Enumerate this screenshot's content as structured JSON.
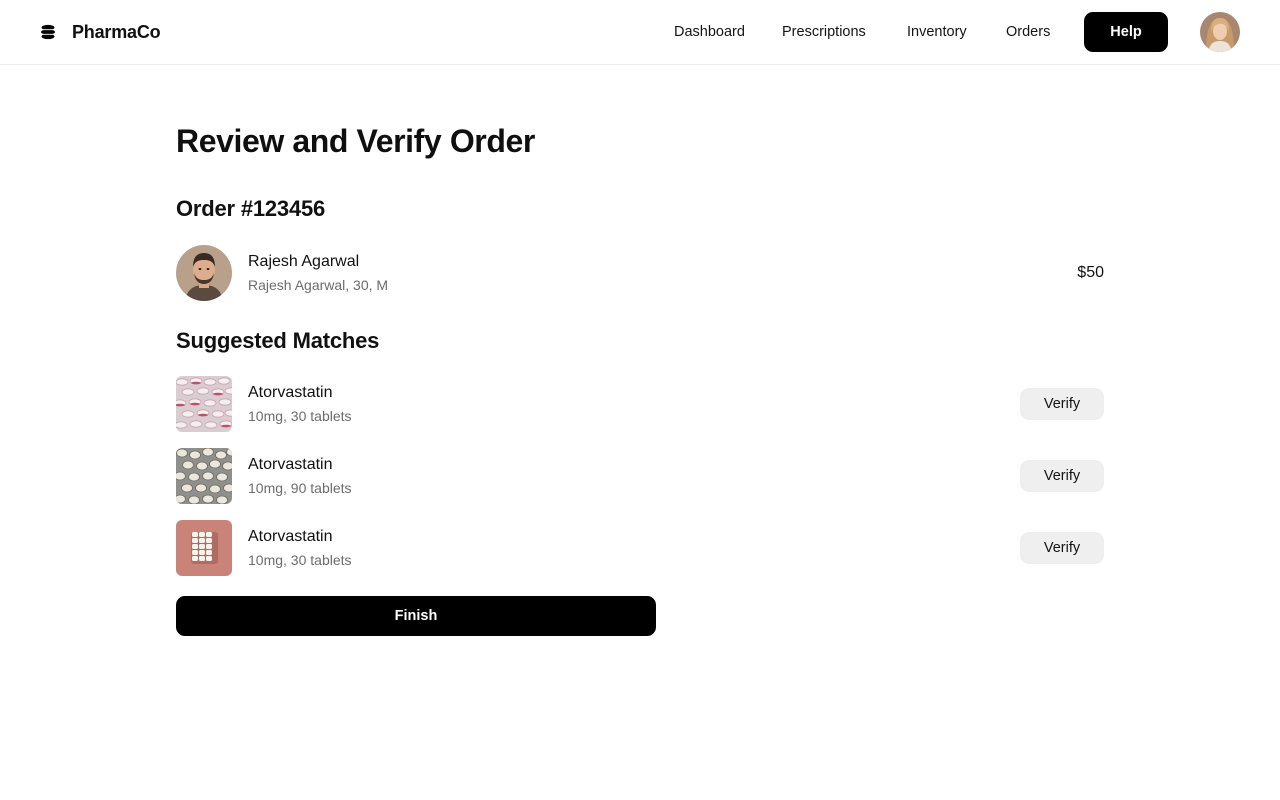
{
  "header": {
    "brand": "PharmaCo",
    "brand_icon": "stacked-layers-icon",
    "nav": [
      "Dashboard",
      "Prescriptions",
      "Inventory",
      "Orders"
    ],
    "help_label": "Help",
    "avatar_icon": "user-avatar"
  },
  "page": {
    "title": "Review and Verify Order"
  },
  "order": {
    "title": "Order #123456",
    "customer": {
      "name": "Rajesh Agarwal",
      "details": "Rajesh Agarwal, 30, M"
    },
    "price": "$50"
  },
  "matches": {
    "title": "Suggested Matches",
    "items": [
      {
        "name": "Atorvastatin",
        "detail": "10mg, 30 tablets",
        "action": "Verify"
      },
      {
        "name": "Atorvastatin",
        "detail": "10mg, 90 tablets",
        "action": "Verify"
      },
      {
        "name": "Atorvastatin",
        "detail": "10mg, 30 tablets",
        "action": "Verify"
      }
    ]
  },
  "finish_label": "Finish",
  "colors": {
    "primary": "#000000",
    "secondary_button": "#efefef",
    "muted_text": "#6c6c6c"
  }
}
